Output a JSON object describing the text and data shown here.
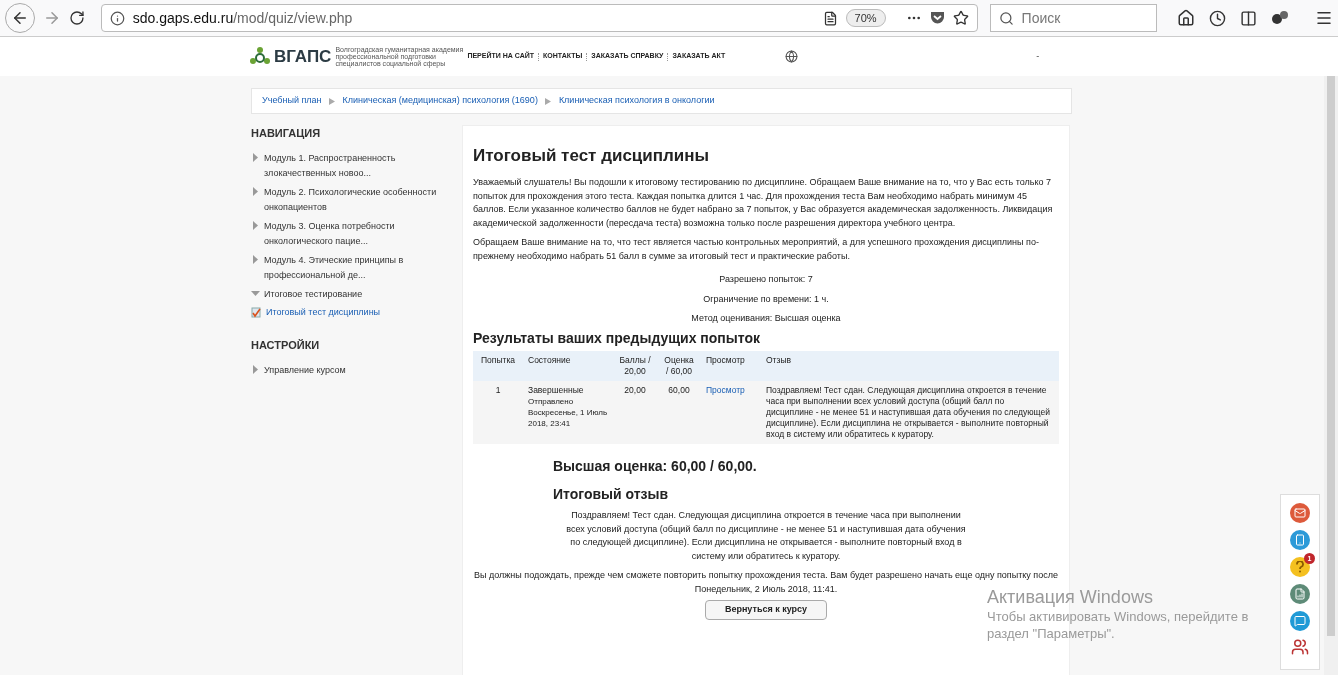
{
  "browser": {
    "url_host": "sdo.gaps.edu.ru",
    "url_path": "/mod/quiz/view.php",
    "zoom": "70%",
    "search_placeholder": "Поиск"
  },
  "header": {
    "logo_text": "ВГАПС",
    "logo_subtitle": "Волгоградская гуманитарная академия профессиональной подготовки специалистов социальной сферы",
    "menu": [
      "ПЕРЕЙТИ НА САЙТ",
      "КОНТАКТЫ",
      "ЗАКАЗАТЬ СПРАВКУ",
      "ЗАКАЗАТЬ АКТ"
    ],
    "user_marker": "-"
  },
  "breadcrumb": [
    "Учебный план",
    "Клиническая (медицинская) психология (1690)",
    "Клиническая психология в онкологии"
  ],
  "sidebar": [
    {
      "title": "НАВИГАЦИЯ",
      "items": [
        {
          "label": "Модуль 1. Распространенность злокачественных новоо...",
          "expanded": false
        },
        {
          "label": "Модуль 2. Психологические особенности онкопациентов",
          "expanded": false
        },
        {
          "label": "Модуль 3. Оценка потребности онкологического пацие...",
          "expanded": false
        },
        {
          "label": "Модуль 4. Этические принципы в профессиональной де...",
          "expanded": false
        },
        {
          "label": "Итоговое тестирование",
          "expanded": true,
          "children": [
            {
              "label": "Итоговый тест дисциплины",
              "kind": "quiz",
              "selected": true
            }
          ]
        }
      ]
    },
    {
      "title": "НАСТРОЙКИ",
      "items": [
        {
          "label": "Управление курсом",
          "expanded": false
        }
      ]
    }
  ],
  "main": {
    "title": "Итоговый тест дисциплины",
    "paragraphs": [
      "Уважаемый слушатель! Вы подошли к итоговому тестированию по дисциплине. Обращаем Ваше внимание на то, что у Вас есть только 7 попыток для прохождения этого теста.  Каждая попытка длится 1 час. Для прохождения теста Вам необходимо набрать минимум 45 баллов. Если указанное количество баллов не будет набрано за 7 попыток, у Вас образуется академическая задолженность. Ликвидация академической задолженности (пересдача теста) возможна только после разрешения директора учебного центра.",
      "Обращаем Ваше внимание на то, что тест является частью контрольных мероприятий, а для успешного прохождения дисциплины по-прежнему необходимо набрать 51 балл в сумме за итоговый тест и практические работы."
    ],
    "info": [
      "Разрешено попыток: 7",
      "Ограничение по времени: 1 ч.",
      "Метод оценивания: Высшая оценка"
    ],
    "results_title": "Результаты ваших предыдущих попыток",
    "table": {
      "columns": [
        "Попытка",
        "Состояние",
        "Баллы / 20,00",
        "Оценка / 60,00",
        "Просмотр",
        "Отзыв"
      ],
      "rows": [
        {
          "attempt": "1",
          "state": "Завершенные",
          "submitted": "Отправлено Воскресенье, 1 Июль 2018, 23:41",
          "marks": "20,00",
          "grade": "60,00",
          "review": "Просмотр",
          "feedback": "Поздравляем! Тест сдан. Следующая дисциплина откроется в течение часа при выполнении всех условий доступа (общий балл по дисциплине - не менее 51 и наступившая дата обучения по следующей дисциплине). Если дисциплина не открывается - выполните повторный вход в систему или обратитесь к куратору."
        }
      ]
    },
    "best_grade": "Высшая оценка: 60,00 / 60,00.",
    "feedback_title": "Итоговый отзыв",
    "feedback_text": "Поздравляем! Тест сдан. Следующая дисциплина откроется в течение часа при выполнении всех условий доступа (общий балл по дисциплине - не менее 51 и наступившая дата обучения по следующей дисциплине). Если дисциплина не открывается - выполните повторный вход в систему или обратитесь к куратору.",
    "wait_text": "Вы должны подождать, прежде чем сможете повторить попытку прохождения теста. Вам будет разрешено начать еще одну попытку после Понедельник, 2 Июль 2018, 11:41.",
    "back_button": "Вернуться к курсу"
  },
  "floating_panel": {
    "help_badge": "1"
  },
  "windows_notice": {
    "title": "Активация Windows",
    "text": "Чтобы активировать Windows, перейдите в раздел \"Параметры\"."
  }
}
